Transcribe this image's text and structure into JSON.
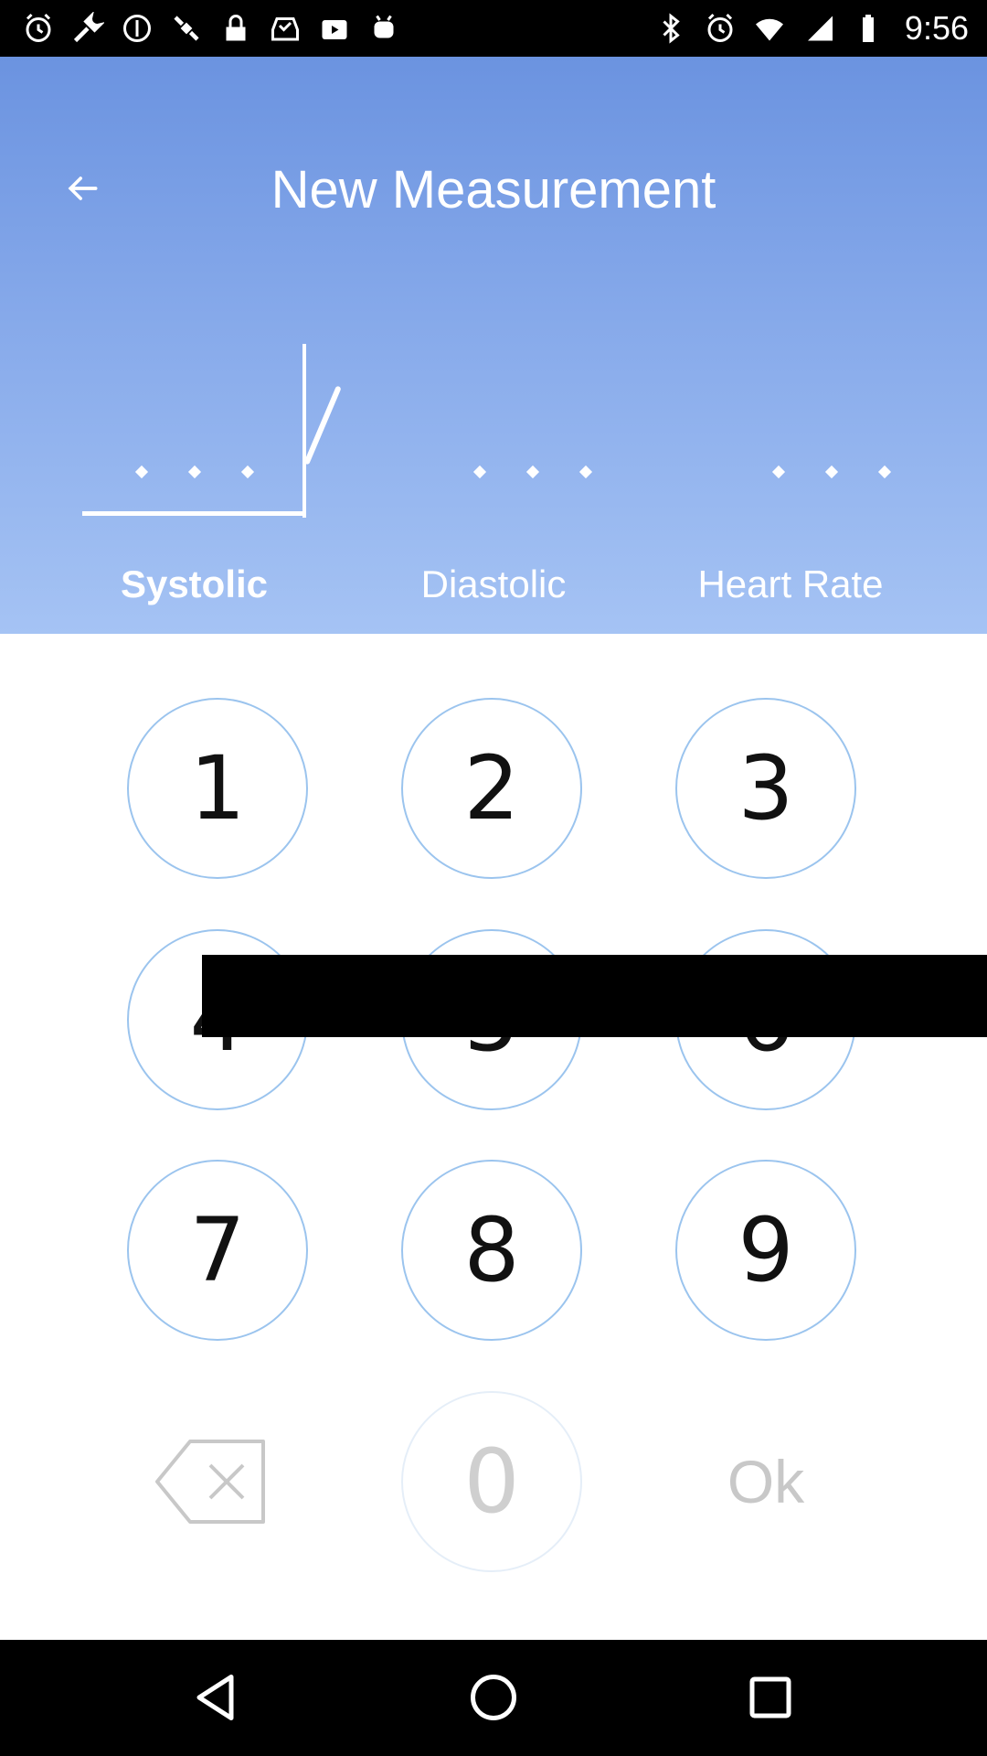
{
  "status_bar": {
    "time": "9:56",
    "left_icons": [
      "alarm-icon",
      "wrench-icon",
      "info-icon",
      "satellite-icon",
      "lock-icon",
      "inbox-check-icon",
      "play-store-icon",
      "android-icon"
    ],
    "right_icons": [
      "bluetooth-icon",
      "alarm-icon",
      "wifi-icon",
      "signal-icon",
      "battery-icon"
    ]
  },
  "header": {
    "title": "New Measurement",
    "gradient_top": "#6b93e0",
    "gradient_bottom": "#a5c3f4",
    "fields": [
      {
        "label": "Systolic",
        "active": true
      },
      {
        "label": "Diastolic",
        "active": false
      },
      {
        "label": "Heart Rate",
        "active": false
      }
    ]
  },
  "keypad": {
    "keys": [
      "1",
      "2",
      "3",
      "4",
      "5",
      "6",
      "7",
      "8",
      "9"
    ],
    "zero": "0",
    "ok": "Ok",
    "accent": "#9bc4ee"
  }
}
